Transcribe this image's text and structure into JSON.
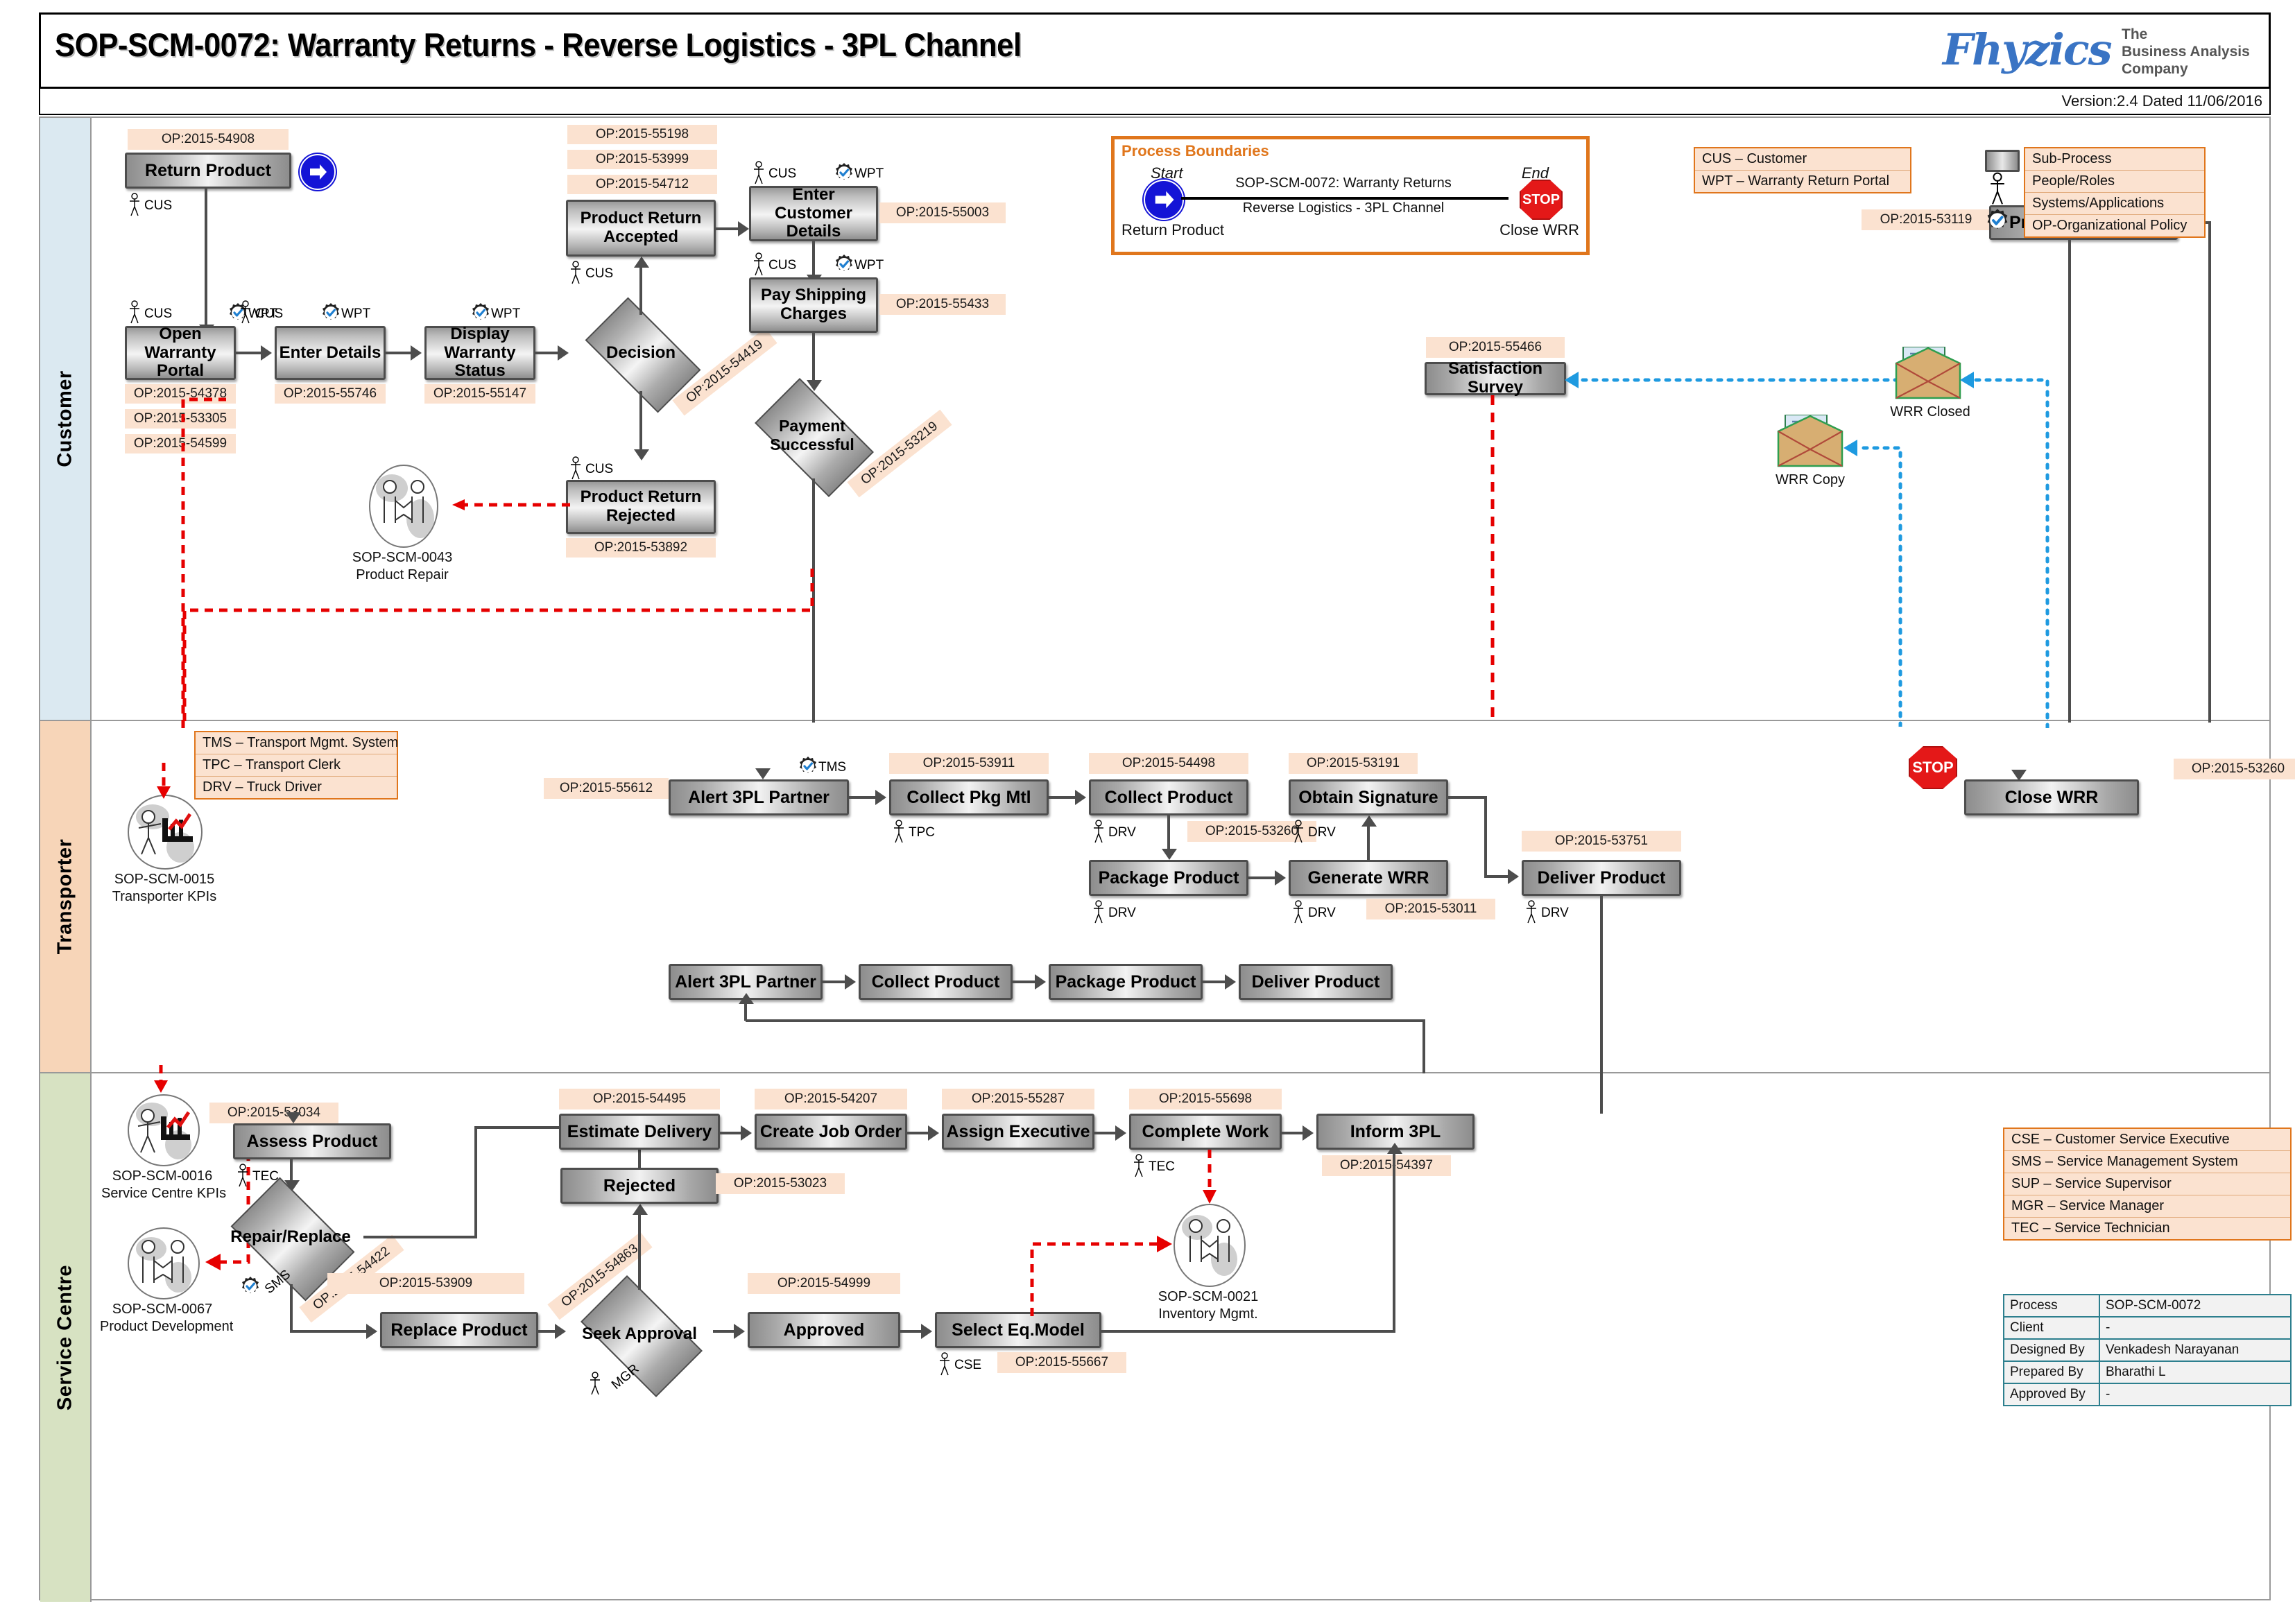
{
  "header": {
    "title": "SOP-SCM-0072: Warranty Returns - Reverse Logistics - 3PL Channel",
    "logo_mark": "Fhyzics",
    "logo_tagline": "The\nBusiness Analysis\nCompany",
    "version": "Version:2.4 Dated 11/06/2016"
  },
  "lanes": [
    {
      "name": "Customer"
    },
    {
      "name": "Transporter"
    },
    {
      "name": "Service Centre"
    }
  ],
  "process_boundaries": {
    "title": "Process Boundaries",
    "start_label": "Start",
    "end_label": "End",
    "start_node": "Return Product",
    "end_node": "Close WRR",
    "line_text_1": "SOP-SCM-0072: Warranty Returns",
    "line_text_2": "Reverse Logistics - 3PL Channel",
    "stop_text": "STOP"
  },
  "legend_customer": [
    "CUS – Customer",
    "WPT – Warranty Return Portal"
  ],
  "legend_shapes": [
    "Sub-Process",
    "People/Roles",
    "Systems/Applications",
    "OP-Organizational Policy"
  ],
  "legend_transporter": [
    "TMS – Transport Mgmt. System",
    "TPC – Transport Clerk",
    "DRV – Truck Driver"
  ],
  "legend_service": [
    "CSE – Customer Service Executive",
    "SMS – Service Management System",
    "SUP – Service Supervisor",
    "MGR – Service Manager",
    "TEC – Service Technician"
  ],
  "info_table": {
    "rows": [
      {
        "key": "Process",
        "value": "SOP-SCM-0072"
      },
      {
        "key": "Client",
        "value": "-"
      },
      {
        "key": "Designed By",
        "value": "Venkadesh Narayanan"
      },
      {
        "key": "Prepared By",
        "value": "Bharathi L"
      },
      {
        "key": "Approved By",
        "value": "-"
      }
    ]
  },
  "customer": {
    "nodes": {
      "return_product": "Return Product",
      "open_warranty_portal": "Open Warranty Portal",
      "enter_details": "Enter Details",
      "display_warranty_status": "Display Warranty Status",
      "decision": "Decision",
      "product_return_accepted": "Product Return Accepted",
      "product_return_rejected": "Product Return Rejected",
      "enter_customer_details": "Enter Customer Details",
      "pay_shipping_charges": "Pay Shipping Charges",
      "payment_successful": "Payment Successful",
      "satisfaction_survey": "Satisfaction Survey",
      "product_delivered": "Product Delivered"
    },
    "ops": {
      "return_product": "OP:2015-54908",
      "open_portal_1": "OP:2015-54378",
      "open_portal_2": "OP:2015-53305",
      "open_portal_3": "OP:2015-54599",
      "enter_details": "OP:2015-55746",
      "display_status": "OP:2015-55147",
      "decision": "OP:2015-54419",
      "accepted_1": "OP:2015-55198",
      "accepted_2": "OP:2015-53999",
      "accepted_3": "OP:2015-54712",
      "rejected": "OP:2015-53892",
      "enter_customer_details": "OP:2015-55003",
      "pay_shipping": "OP:2015-55433",
      "payment_successful": "OP:2015-53219",
      "satisfaction_survey": "OP:2015-55466",
      "product_delivered": "OP:2015-53119"
    },
    "roles": {
      "cus": "CUS",
      "wpt": "WPT"
    },
    "artifacts": {
      "wrr_closed": "WRR Closed",
      "wrr_copy": "WRR Copy"
    },
    "subprocess": {
      "code": "SOP-SCM-0043",
      "label": "Product Repair"
    }
  },
  "transporter": {
    "nodes": {
      "alert_3pl_partner": "Alert 3PL Partner",
      "collect_pkg_mtl": "Collect Pkg Mtl",
      "collect_product": "Collect Product",
      "obtain_signature": "Obtain Signature",
      "close_wrr": "Close WRR",
      "package_product": "Package Product",
      "generate_wrr": "Generate WRR",
      "deliver_product": "Deliver Product",
      "row2_alert_3pl_partner": "Alert 3PL Partner",
      "row2_collect_product": "Collect Product",
      "row2_package_product": "Package Product",
      "row2_deliver_product": "Deliver Product"
    },
    "ops": {
      "alert_3pl_partner": "OP:2015-55612",
      "collect_pkg_mtl": "OP:2015-53911",
      "collect_product": "OP:2015-54498",
      "obtain_signature": "OP:2015-53191",
      "close_wrr": "OP:2015-53260",
      "package_product": "OP:2015-53260",
      "generate_wrr": "OP:2015-53011",
      "deliver_product": "OP:2015-53751"
    },
    "roles": {
      "tms": "TMS",
      "tpc": "TPC",
      "drv": "DRV"
    },
    "subprocess": {
      "code": "SOP-SCM-0015",
      "label": "Transporter KPIs"
    },
    "stop_text": "STOP"
  },
  "service": {
    "nodes": {
      "assess_product": "Assess Product",
      "repair_replace": "Repair/Replace",
      "replace_product": "Replace Product",
      "seek_approval": "Seek Approval",
      "approved": "Approved",
      "select_eq_model": "Select Eq.Model",
      "rejected": "Rejected",
      "estimate_delivery": "Estimate Delivery",
      "create_job_order": "Create Job Order",
      "assign_executive": "Assign Executive",
      "complete_work": "Complete Work",
      "inform_3pl": "Inform 3PL"
    },
    "ops": {
      "assess_product": "OP:2015-53034",
      "repair_replace": "OP:2015-54422",
      "replace_product": "OP:2015-53909",
      "seek_approval": "OP:2015-54863",
      "approved": "OP:2015-54999",
      "select_eq_model": "OP:2015-55667",
      "rejected": "OP:2015-53023",
      "estimate_delivery": "OP:2015-54495",
      "create_job_order": "OP:2015-54207",
      "assign_executive": "OP:2015-55287",
      "complete_work": "OP:2015-55698",
      "inform_3pl": "OP:2015-54397"
    },
    "roles": {
      "tec": "TEC",
      "sms": "SMS",
      "mgr": "MGR",
      "cse": "CSE"
    },
    "subprocesses": [
      {
        "code": "SOP-SCM-0016",
        "label": "Service Centre KPIs"
      },
      {
        "code": "SOP-SCM-0067",
        "label": "Product Development"
      },
      {
        "code": "SOP-SCM-0021",
        "label": "Inventory Mgmt."
      }
    ]
  },
  "colors": {
    "accent_orange": "#e0761c",
    "op_chip": "#fbe2d0",
    "lane_customer": "#dbe9f1",
    "lane_transporter": "#f7d5b8",
    "lane_service": "#d7e2c2",
    "red_dashed": "#e60000",
    "blue_dashed": "#1e9ae0",
    "brand_blue": "#3a74c4"
  }
}
